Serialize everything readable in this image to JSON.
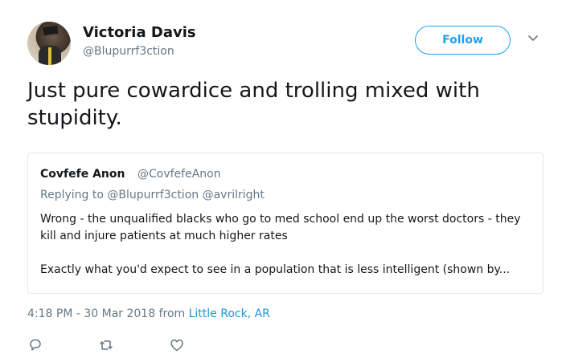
{
  "author": {
    "name": "Victoria Davis",
    "handle": "@Blupurrf3ction",
    "avatar_icon": "profile-photo"
  },
  "header": {
    "follow_label": "Follow",
    "caret_icon": "chevron-down-icon"
  },
  "tweet": {
    "text": "Just pure cowardice and trolling mixed with stupidity."
  },
  "quoted": {
    "name": "Covfefe Anon",
    "handle": "@CovfefeAnon",
    "replying_prefix": "Replying to ",
    "replying_mentions": "@Blupurrf3ction @avrilright",
    "paragraph1": "Wrong - the unqualified blacks who go to med school end up the worst doctors - they kill and injure patients at much higher rates",
    "paragraph2": "Exactly what you'd expect to see in a population that is less intelligent (shown by..."
  },
  "meta": {
    "timestamp": "4:18 PM - 30 Mar 2018 from ",
    "location": "Little Rock, AR"
  },
  "actions": {
    "reply_icon": "reply-icon",
    "retweet_icon": "retweet-icon",
    "like_icon": "heart-icon"
  },
  "colors": {
    "accent": "#1da1f2",
    "secondary_text": "#657786",
    "primary_text": "#14171a",
    "border": "#e1e8ed"
  }
}
